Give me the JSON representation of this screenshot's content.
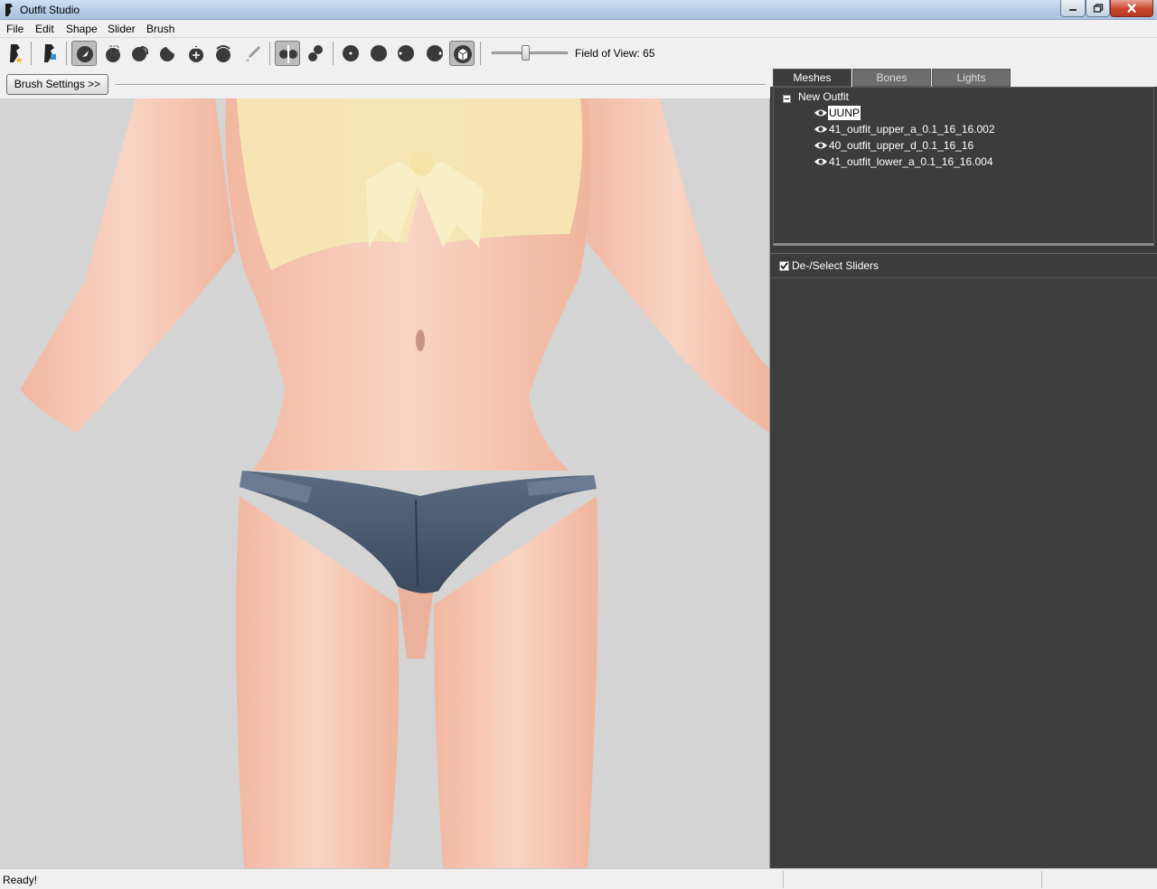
{
  "window": {
    "title": "Outfit Studio"
  },
  "menu": [
    "File",
    "Edit",
    "Shape",
    "Slider",
    "Brush"
  ],
  "toolbar": {
    "icons": [
      "new-project-icon",
      "load-outfit-icon",
      "select-brush-icon",
      "mask-brush-icon",
      "inflate-brush-icon",
      "deflate-brush-icon",
      "move-brush-icon",
      "smooth-brush-icon",
      "weight-brush-icon",
      "x-mirror-icon",
      "connected-only-icon",
      "brush-size-small-icon",
      "brush-size-medium-icon",
      "brush-size-large-icon",
      "brush-size-xlarge-icon",
      "cube-view-icon"
    ],
    "field_of_view_label": "Field of View: 65",
    "field_of_view_value": 65
  },
  "brush": {
    "settings_label": "Brush Settings >>"
  },
  "panel": {
    "tabs": [
      "Meshes",
      "Bones",
      "Lights"
    ],
    "active_tab": "Meshes",
    "tree": {
      "root": "New Outfit",
      "meshes": [
        "UUNP",
        "41_outfit_upper_a_0.1_16_16.002",
        "40_outfit_upper_d_0.1_16_16",
        "41_outfit_lower_a_0.1_16_16.004"
      ],
      "selected": "UUNP"
    },
    "sliders_label": "De-/Select Sliders",
    "sliders_checked": true
  },
  "status": {
    "text": "Ready!"
  },
  "colors": {
    "panel_dark": "#3c3c3c",
    "viewport_bg": "#d4d4d4",
    "skin": "#f4c4b0",
    "top": "#f6e8b8",
    "shorts": "#4a5a6e"
  }
}
